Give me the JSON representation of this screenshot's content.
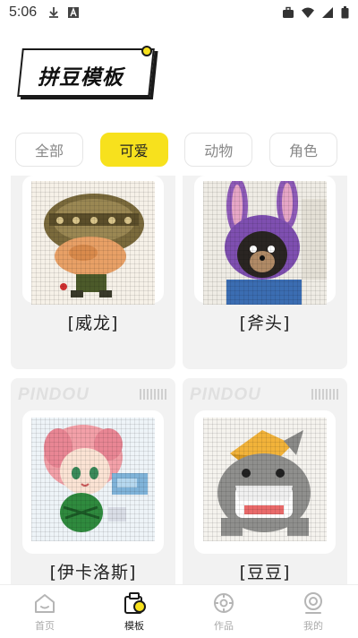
{
  "status_bar": {
    "time": "5:06"
  },
  "header": {
    "title": "拼豆模板"
  },
  "tabs": [
    {
      "label": "全部",
      "active": false
    },
    {
      "label": "可爱",
      "active": true
    },
    {
      "label": "动物",
      "active": false
    },
    {
      "label": "角色",
      "active": false
    }
  ],
  "cards": [
    {
      "name": "[威龙]",
      "brand": ""
    },
    {
      "name": "[斧头]",
      "brand": ""
    },
    {
      "name": "[伊卡洛斯]",
      "brand": "PINDOU"
    },
    {
      "name": "[豆豆]",
      "brand": "PINDOU"
    }
  ],
  "bottom_nav": [
    {
      "label": "首页",
      "icon": "home-icon",
      "active": false
    },
    {
      "label": "模板",
      "icon": "template-icon",
      "active": true
    },
    {
      "label": "作品",
      "icon": "works-icon",
      "active": false
    },
    {
      "label": "我的",
      "icon": "profile-icon",
      "active": false
    }
  ],
  "colors": {
    "accent": "#f7e11d",
    "card_bg": "#f2f2f2",
    "inactive_text": "#888888"
  }
}
